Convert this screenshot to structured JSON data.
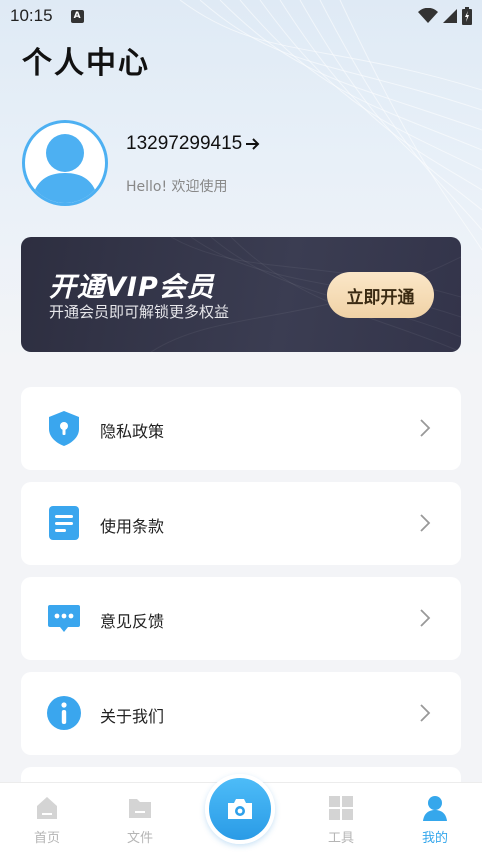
{
  "status_bar": {
    "time": "10:15",
    "notif_badge": "A"
  },
  "page": {
    "title": "个人中心"
  },
  "profile": {
    "phone": "13297299415",
    "greeting": "Hello! 欢迎使用"
  },
  "vip": {
    "title": "开通VIP会员",
    "subtitle": "开通会员即可解锁更多权益",
    "button_label": "立即开通"
  },
  "menu": {
    "items": [
      {
        "label": "隐私政策",
        "icon": "shield-lock-icon"
      },
      {
        "label": "使用条款",
        "icon": "document-icon"
      },
      {
        "label": "意见反馈",
        "icon": "chat-bubble-icon"
      },
      {
        "label": "关于我们",
        "icon": "info-icon"
      }
    ]
  },
  "tabbar": {
    "tabs": [
      {
        "label": "首页",
        "icon": "home-icon",
        "active": false
      },
      {
        "label": "文件",
        "icon": "folder-icon",
        "active": false
      },
      {
        "label": "",
        "icon": "camera-icon",
        "active": false
      },
      {
        "label": "工具",
        "icon": "grid-icon",
        "active": false
      },
      {
        "label": "我的",
        "icon": "user-icon",
        "active": true
      }
    ]
  },
  "colors": {
    "accent": "#35a7ec",
    "vip_bg": "#2d2e40",
    "vip_button": "#f0d2a6",
    "icon_blue": "#3aa6ee",
    "page_bg": "#f3f4f7"
  }
}
